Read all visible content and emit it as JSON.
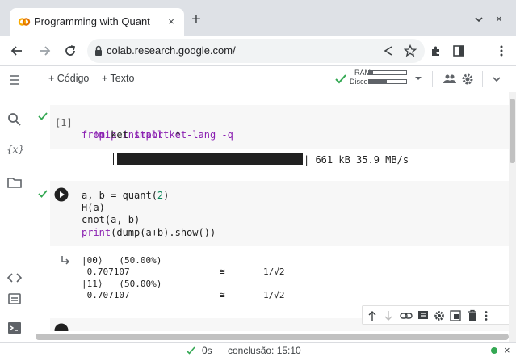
{
  "browser": {
    "tab_title": "Programming with Quant",
    "tab_close": "×",
    "new_tab": "+",
    "window_close": "×",
    "url": "colab.research.google.com/"
  },
  "colab": {
    "add_code": "+ Código",
    "add_text": "+ Texto",
    "ram_label": "RAM",
    "disk_label": "Disco"
  },
  "cells": {
    "cell1": {
      "exec_count": "[1]",
      "line1_cmd": "!pip install ket-lang -q",
      "line2_from": "from",
      "line2_mod": " ket ",
      "line2_import": "import",
      "line2_rest": " *",
      "progress_text": "| 661 kB 35.9 MB/s",
      "progress_fraction": 1.0
    },
    "cell2": {
      "line1": "a, b = quant(",
      "line1_num": "2",
      "line1_end": ")",
      "line2": "H(a)",
      "line3": "cnot(a, b)",
      "line4_print": "print",
      "line4_rest": "(dump(a+b).show())"
    },
    "output": {
      "state1": "|00⟩   (50.00%)",
      "amp1": " 0.707107",
      "approx1": "≅",
      "frac1": "1/√2",
      "state2": "|11⟩   (50.00%)",
      "amp2": " 0.707107",
      "approx2": "≅",
      "frac2": "1/√2"
    }
  },
  "status": {
    "time": "0s",
    "completion": "conclusão: 15:10"
  },
  "colors": {
    "accent_green": "#34a853",
    "tab_strip": "#dee1e6"
  }
}
